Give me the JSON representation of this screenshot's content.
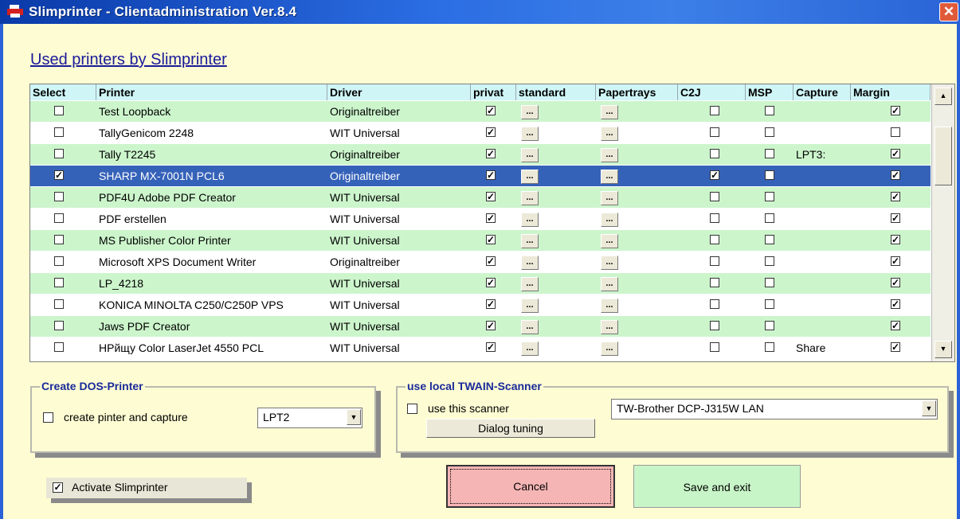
{
  "window": {
    "title": "Slimprinter - Clientadministration   Ver.8.4",
    "close_label": "✕"
  },
  "section_title": "Used printers by Slimprinter",
  "columns": [
    "Select",
    "Printer",
    "Driver",
    "privat",
    "standard",
    "Papertrays",
    "C2J",
    "MSP",
    "Capture",
    "Margin"
  ],
  "ellipsis": "...",
  "rows": [
    {
      "select": false,
      "printer": "Test Loopback",
      "driver": "Originaltreiber",
      "privat": true,
      "c2j": false,
      "msp": false,
      "capture": "",
      "margin": true
    },
    {
      "select": false,
      "printer": "TallyGenicom 2248",
      "driver": "WIT Universal",
      "privat": true,
      "c2j": false,
      "msp": false,
      "capture": "",
      "margin": false
    },
    {
      "select": false,
      "printer": "Tally T2245",
      "driver": "Originaltreiber",
      "privat": true,
      "c2j": false,
      "msp": false,
      "capture": "LPT3:",
      "margin": true
    },
    {
      "select": true,
      "printer": "SHARP MX-7001N PCL6",
      "driver": "Originaltreiber",
      "privat": true,
      "c2j": true,
      "msp": false,
      "capture": "",
      "margin": true
    },
    {
      "select": false,
      "printer": "PDF4U Adobe PDF Creator",
      "driver": "WIT Universal",
      "privat": true,
      "c2j": false,
      "msp": false,
      "capture": "",
      "margin": true
    },
    {
      "select": false,
      "printer": "PDF erstellen",
      "driver": "WIT Universal",
      "privat": true,
      "c2j": false,
      "msp": false,
      "capture": "",
      "margin": true
    },
    {
      "select": false,
      "printer": "MS Publisher Color Printer",
      "driver": "WIT Universal",
      "privat": true,
      "c2j": false,
      "msp": false,
      "capture": "",
      "margin": true
    },
    {
      "select": false,
      "printer": "Microsoft XPS Document Writer",
      "driver": "Originaltreiber",
      "privat": true,
      "c2j": false,
      "msp": false,
      "capture": "",
      "margin": true
    },
    {
      "select": false,
      "printer": "LP_4218",
      "driver": "WIT Universal",
      "privat": true,
      "c2j": false,
      "msp": false,
      "capture": "",
      "margin": true
    },
    {
      "select": false,
      "printer": "KONICA MINOLTA C250/C250P VPS",
      "driver": "WIT Universal",
      "privat": true,
      "c2j": false,
      "msp": false,
      "capture": "",
      "margin": true
    },
    {
      "select": false,
      "printer": "Jaws PDF Creator",
      "driver": "WIT Universal",
      "privat": true,
      "c2j": false,
      "msp": false,
      "capture": "",
      "margin": true
    },
    {
      "select": false,
      "printer": "HPйщу Color LaserJet 4550 PCL",
      "driver": "WIT Universal",
      "privat": true,
      "c2j": false,
      "msp": false,
      "capture": "Share",
      "margin": true
    }
  ],
  "selected_row_index": 3,
  "dos_printer": {
    "title": "Create DOS-Printer",
    "checkbox_label": "create pinter and capture",
    "checked": false,
    "port_value": "LPT2"
  },
  "twain": {
    "title": "use local TWAIN-Scanner",
    "checkbox_label": "use this scanner",
    "checked": false,
    "tuning_label": "Dialog tuning",
    "scanner_value": "TW-Brother DCP-J315W LAN"
  },
  "activate": {
    "label": "Activate Slimprinter",
    "checked": true
  },
  "buttons": {
    "cancel": "Cancel",
    "save": "Save and exit"
  },
  "colors": {
    "row_green": "#ccf5cc",
    "row_selected": "#3562b9",
    "header": "#cff5f7",
    "cancel": "#f6b5b5",
    "save": "#c8f5c8",
    "background": "#fdfcd3"
  }
}
